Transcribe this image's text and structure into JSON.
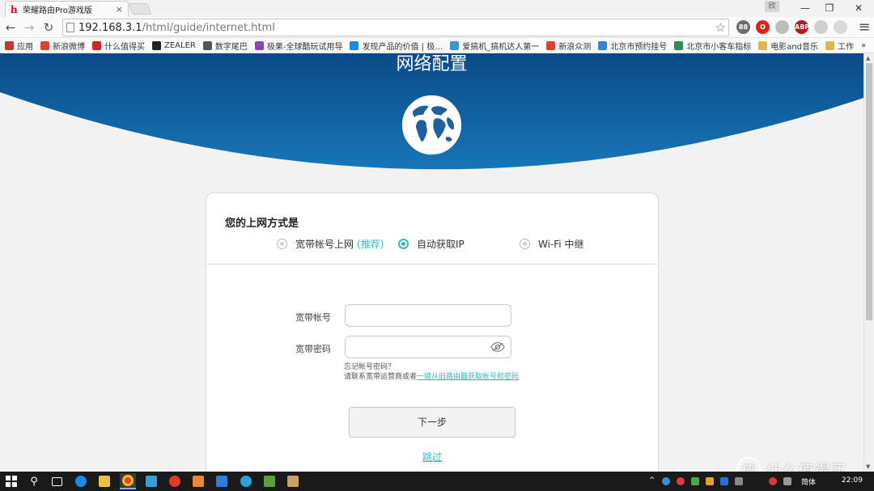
{
  "browser": {
    "tab_title": "荣耀路由Pro游戏版",
    "tab_close": "×",
    "user_chip": "欣",
    "window_controls": {
      "minimize": "—",
      "restore": "❐",
      "close": "✕"
    },
    "nav": {
      "back": "←",
      "forward": "→",
      "reload": "↻"
    },
    "url_host": "192.168.3.1",
    "url_path": "/html/guide/internet.html",
    "star": "☆",
    "extensions": [
      {
        "name": "cloud-ext",
        "label": "88",
        "color": "#6d6d6d"
      },
      {
        "name": "opera-ext",
        "label": "O",
        "color": "#e0201b"
      },
      {
        "name": "chrome-ext",
        "label": "",
        "color": "#bdbdbd"
      },
      {
        "name": "adblock-ext",
        "label": "ABP",
        "color": "#c8101e"
      },
      {
        "name": "pocket-ext",
        "label": "",
        "color": "#cfcfcf"
      },
      {
        "name": "flag-ext",
        "label": "",
        "color": "#d9d9d9"
      }
    ],
    "menu_icon": "≡",
    "bookmarks": [
      {
        "label": "应用",
        "color": "#c0392b"
      },
      {
        "label": "新浪微博",
        "color": "#e2412c"
      },
      {
        "label": "什么值得买",
        "color": "#d4232f"
      },
      {
        "label": "ZEALER",
        "color": "#222222"
      },
      {
        "label": "数字尾巴",
        "color": "#555555"
      },
      {
        "label": "极果-全球酷玩试用导",
        "color": "#8e44ad"
      },
      {
        "label": "发现产品的价值 | 极…",
        "color": "#1e88e5"
      },
      {
        "label": "爱搞机_搞机达人第一",
        "color": "#3498db"
      },
      {
        "label": "新浪众测",
        "color": "#e2412c"
      },
      {
        "label": "北京市预约挂号",
        "color": "#2e86de"
      },
      {
        "label": "北京市小客车指标",
        "color": "#2e8b57"
      },
      {
        "label": "电影and音乐",
        "color": "#e0b64a"
      },
      {
        "label": "工作",
        "color": "#e0b64a"
      }
    ],
    "bookmarks_more": "»"
  },
  "page": {
    "title": "网络配置",
    "heading": "您的上网方式是",
    "options": [
      {
        "label": "宽带帐号上网",
        "extra": "(推荐)",
        "checked": false
      },
      {
        "label": "自动获取IP",
        "extra": "",
        "checked": true
      },
      {
        "label": "Wi-Fi 中继",
        "extra": "",
        "checked": false
      }
    ],
    "fields": {
      "account_label": "宽带帐号",
      "account_value": "",
      "password_label": "宽带密码",
      "password_value": ""
    },
    "hint_line1": "忘记帐号密码？",
    "hint_line2_prefix": "请联系宽带运营商或者",
    "hint_line2_link": "一键从旧路由器获取帐号和密码",
    "next_button": "下一步",
    "skip_link": "跳过",
    "colors": {
      "accent": "#3bb6bd",
      "header_dark": "#0b4a87",
      "header_light": "#1776b8"
    }
  },
  "watermark": {
    "symbol": "值",
    "text": "什么值得买"
  },
  "taskbar": {
    "tray_lang": "简体",
    "tray_time": "22:09",
    "tray_arrow": "^"
  }
}
